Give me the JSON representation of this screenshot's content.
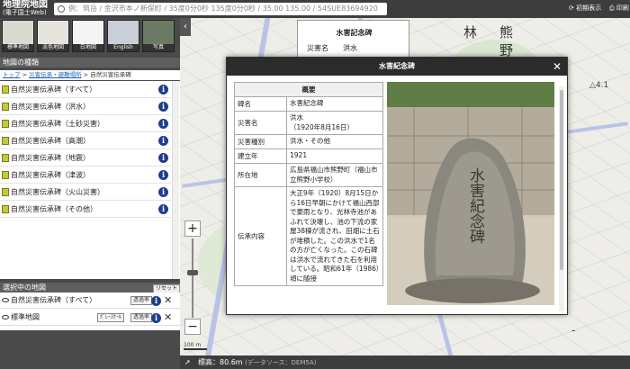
{
  "app": {
    "logo_line1": "地理院地図",
    "logo_line2": "(電子国土Web)"
  },
  "search": {
    "placeholder": "例：筑岳 / 金沢市本ノ新保町 / 35度0分0秒 135度0分0秒 / 35.00 135.00 / 54SUE83694920"
  },
  "topbar": {
    "init_view": "初期表示",
    "print": "印刷"
  },
  "basemaps": [
    {
      "label": "標準地図"
    },
    {
      "label": "淡色地図"
    },
    {
      "label": "白地図"
    },
    {
      "label": "English"
    },
    {
      "label": "写真"
    }
  ],
  "panel": {
    "map_types_title": "地図の種類",
    "breadcrumb_top": "トップ",
    "breadcrumb_mid": "災害伝承・避難場所",
    "breadcrumb_cur": "自然災害伝承碑",
    "items": [
      {
        "label": "自然災害伝承碑（すべて）"
      },
      {
        "label": "自然災害伝承碑（洪水）"
      },
      {
        "label": "自然災害伝承碑（土砂災害）"
      },
      {
        "label": "自然災害伝承碑（高潮）"
      },
      {
        "label": "自然災害伝承碑（地震）"
      },
      {
        "label": "自然災害伝承碑（津波）"
      },
      {
        "label": "自然災害伝承碑（火山災害）"
      },
      {
        "label": "自然災害伝承碑（その他）"
      }
    ],
    "selected_title": "選択中の地図",
    "reset": "リセット",
    "selected": [
      {
        "label": "自然災害伝承碑（すべて）",
        "btn1": "透過率"
      },
      {
        "label": "標準地図",
        "btn0": "ｸﾞﾚｰｽｹｰﾙ",
        "btn1": "透過率"
      }
    ]
  },
  "map": {
    "labels": [
      "林",
      "熊",
      "野"
    ],
    "scale": "100 m",
    "elev_num": "4.1",
    "dash": "-"
  },
  "bottombar": {
    "elevation": "標高：80.6m",
    "source": "(データソース：DEM5A)"
  },
  "bg_popup": {
    "title": "水害記念碑",
    "k": "災害名",
    "v": "洪水"
  },
  "modal": {
    "title": "水害紀念碑",
    "table_header": "概要",
    "rows": [
      {
        "k": "碑名",
        "v": "水害紀念碑"
      },
      {
        "k": "災害名",
        "v": "洪水\n（1920年8月16日）"
      },
      {
        "k": "災害種別",
        "v": "洪水・その他"
      },
      {
        "k": "建立年",
        "v": "1921"
      },
      {
        "k": "所在地",
        "v": "広島県福山市熊野町（福山市立熊野小学校）"
      },
      {
        "k": "伝承内容",
        "v": "大正9年（1920）8月15日から16日早朝にかけて福山西部で豪雨となり、光林寺池があふれて決壊し、池の下流の家屋38棟が流され、田畑に土石が堆積した。この洪水で1名の方が亡くなった。この石碑は洪水で流れてきた石を利用している。昭和61年（1986）頃に随接"
      }
    ],
    "stone_text": "水害紀念碑"
  },
  "colors": {
    "topbar": "#3d3d3d",
    "info": "#1e3f8a",
    "item_square": "#c3c93a"
  }
}
